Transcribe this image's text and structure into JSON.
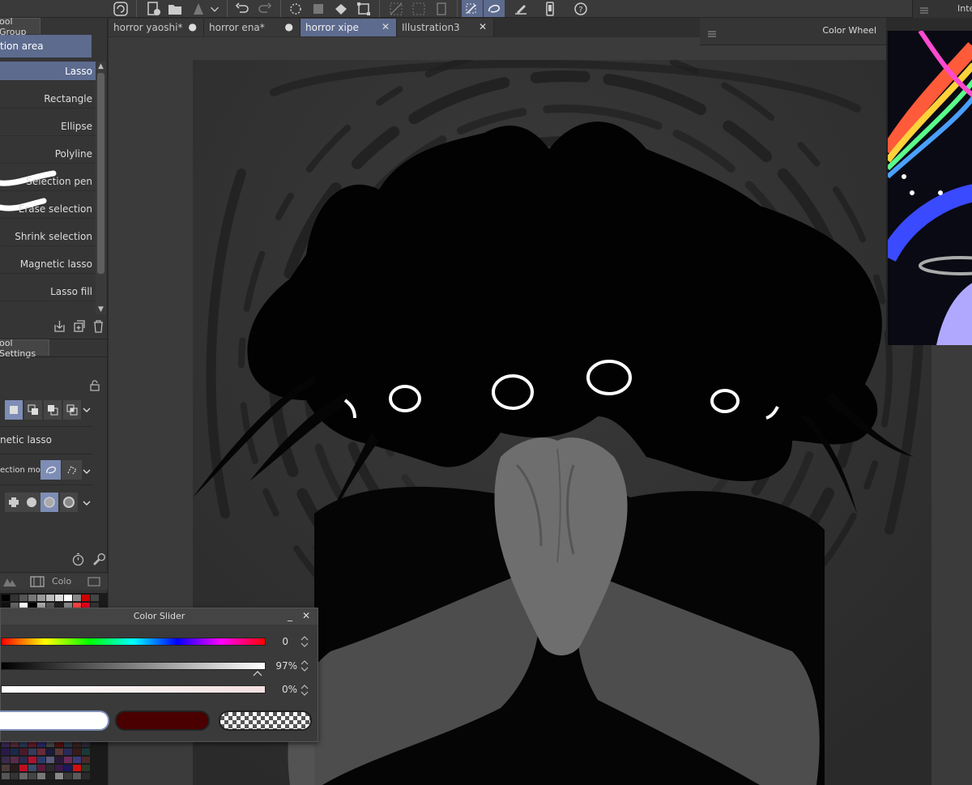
{
  "document_tabs": [
    {
      "label": "horror yaoshi*",
      "mark": "●"
    },
    {
      "label": "horror ena*",
      "mark": "●"
    },
    {
      "label": "horror xipe",
      "mark": "✕"
    },
    {
      "label": "Illustration3",
      "mark": "✕"
    }
  ],
  "left_panel": {
    "tab_label": "ool Group",
    "subtool_header": "tion area",
    "tools": [
      "Lasso",
      "Rectangle",
      "Ellipse",
      "Polyline",
      "Selection pen",
      "Erase selection",
      "Shrink selection",
      "Magnetic lasso",
      "Lasso fill"
    ],
    "tool_settings_tab": "ool Settings",
    "tool_name": "netic lasso",
    "selection_mode_label": "ection mode",
    "color_tab_label": "Colo"
  },
  "right_panel": {
    "color_wheel_title": "Color Wheel",
    "tab_label": "Inte"
  },
  "color_slider": {
    "title": "Color Slider",
    "minimize": "_",
    "close": "✕",
    "hue_value": "0",
    "saturation_value": "97%",
    "brightness_value": "0%"
  },
  "colors": {
    "accent": "#5d6b8f",
    "main_color": "#ffffff",
    "sub_color": "#4a0000"
  }
}
